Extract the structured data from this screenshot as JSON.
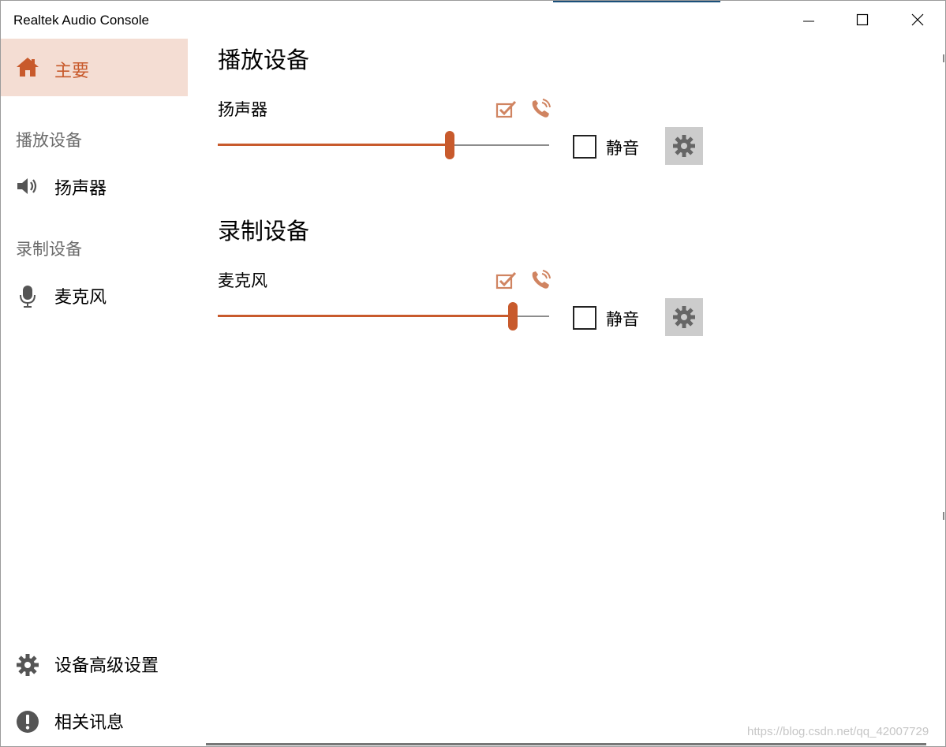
{
  "window": {
    "title": "Realtek Audio Console",
    "colors": {
      "accent": "#c85a2c",
      "selected_bg": "#f4ddd3",
      "gear_bg": "#cccccc"
    }
  },
  "sidebar": {
    "home": {
      "label": "主要",
      "icon": "home-icon"
    },
    "playback_section": "播放设备",
    "speaker": {
      "label": "扬声器",
      "icon": "speaker-icon"
    },
    "recording_section": "录制设备",
    "microphone": {
      "label": "麦克风",
      "icon": "microphone-icon"
    },
    "advanced_settings": {
      "label": "设备高级设置",
      "icon": "gear-icon"
    },
    "info": {
      "label": "相关讯息",
      "icon": "info-icon"
    }
  },
  "main": {
    "playback": {
      "title": "播放设备",
      "device": "扬声器",
      "volume_fraction": 0.7,
      "mute_label": "静音",
      "muted": false,
      "status_icons": [
        "checkmark-icon",
        "phone-icon"
      ]
    },
    "recording": {
      "title": "录制设备",
      "device": "麦克风",
      "volume_fraction": 0.89,
      "mute_label": "静音",
      "muted": false,
      "status_icons": [
        "checkmark-icon",
        "phone-icon"
      ]
    }
  },
  "watermark": "https://blog.csdn.net/qq_42007729"
}
